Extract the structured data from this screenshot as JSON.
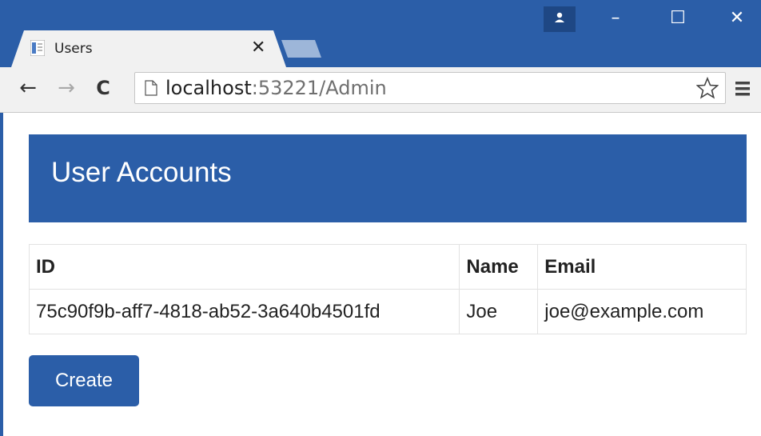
{
  "browser": {
    "tab": {
      "title": "Users",
      "close_glyph": "✕"
    },
    "window_controls": {
      "minimize": "–",
      "maximize": "☐",
      "close": "✕"
    },
    "toolbar": {
      "back_glyph": "←",
      "forward_glyph": "→",
      "reload_glyph": "C",
      "url_host": "localhost",
      "url_rest": ":53221/Admin"
    },
    "icons": {
      "favicon": "page-icon",
      "profile": "person-icon",
      "bookmark": "star-icon",
      "menu": "hamburger-menu-icon"
    }
  },
  "page": {
    "heading": "User Accounts",
    "table": {
      "headers": [
        "ID",
        "Name",
        "Email"
      ],
      "rows": [
        [
          "75c90f9b-aff7-4818-ab52-3a640b4501fd",
          "Joe",
          "joe@example.com"
        ]
      ]
    },
    "create_label": "Create"
  },
  "colors": {
    "brand_blue": "#2b5ea8",
    "toolbar_gray": "#f1f1f1"
  }
}
